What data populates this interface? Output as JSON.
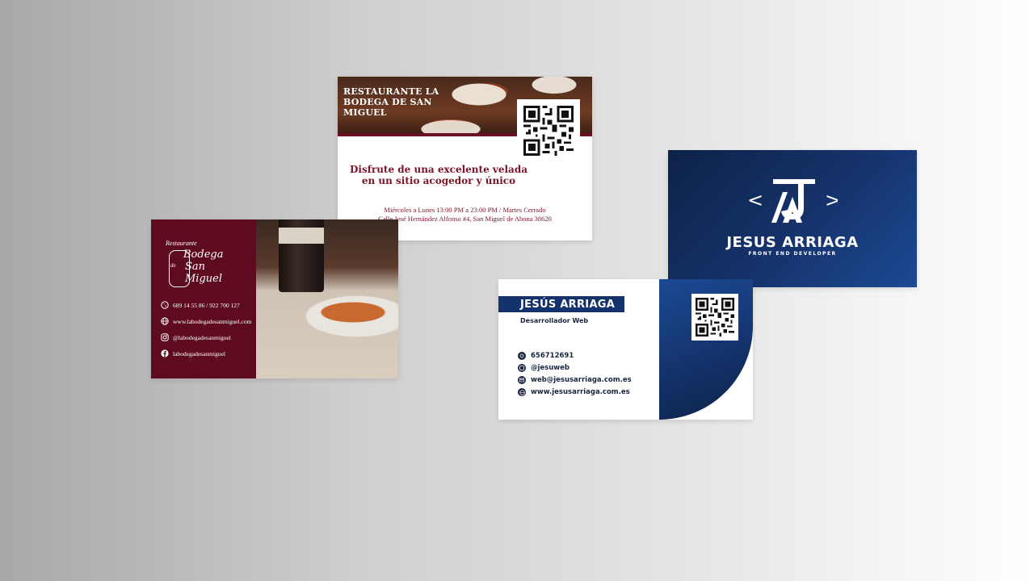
{
  "colors": {
    "bodega_wine": "#5e0b1f",
    "bodega_text": "#7a1428",
    "ja_navy": "#14336c",
    "ja_blue": "#1c4a94",
    "ja_dark_text": "#1a2440"
  },
  "bodega_front": {
    "title": "RESTAURANTE LA BODEGA DE SAN MIGUEL",
    "tagline_line1": "Disfrute de una excelente velada",
    "tagline_line2": "en un sitio acogedor y único",
    "hours": "Miércoles a Lunes 13:00 PM a 23:00 PM / Martes Cerrado",
    "address": "Calle José Hernández Alfonso #4, San Miguel de Abona 38620",
    "qr_icon": "qr-code-icon"
  },
  "bodega_back": {
    "logo_small": "Restaurante",
    "logo_line1": "Bodega",
    "logo_line2": "San Miguel",
    "logo_de": "de",
    "phone": "689 14 55 86 / 922 700 127",
    "website": "www.labodegadesanmiguel.com",
    "instagram": "@labodegadesanmiguel",
    "facebook": "labodegadesanmiguel",
    "icons": [
      "phone-icon",
      "globe-icon",
      "instagram-icon",
      "facebook-icon"
    ]
  },
  "ja_logo": {
    "name": "JESUS ARRIAGA",
    "role": "FRONT END DEVELOPER",
    "bracket_left": "<",
    "bracket_right": ">"
  },
  "ja_contact": {
    "name": "JESÚS ARRIAGA",
    "role": "Desarrollador Web",
    "phone": "656712691",
    "social": "@jesuweb",
    "email": "web@jesusarriaga.com.es",
    "website": "www.jesusarriaga.com.es",
    "icons": [
      "whatsapp-icon",
      "instagram-icon",
      "email-icon",
      "globe-icon"
    ]
  }
}
